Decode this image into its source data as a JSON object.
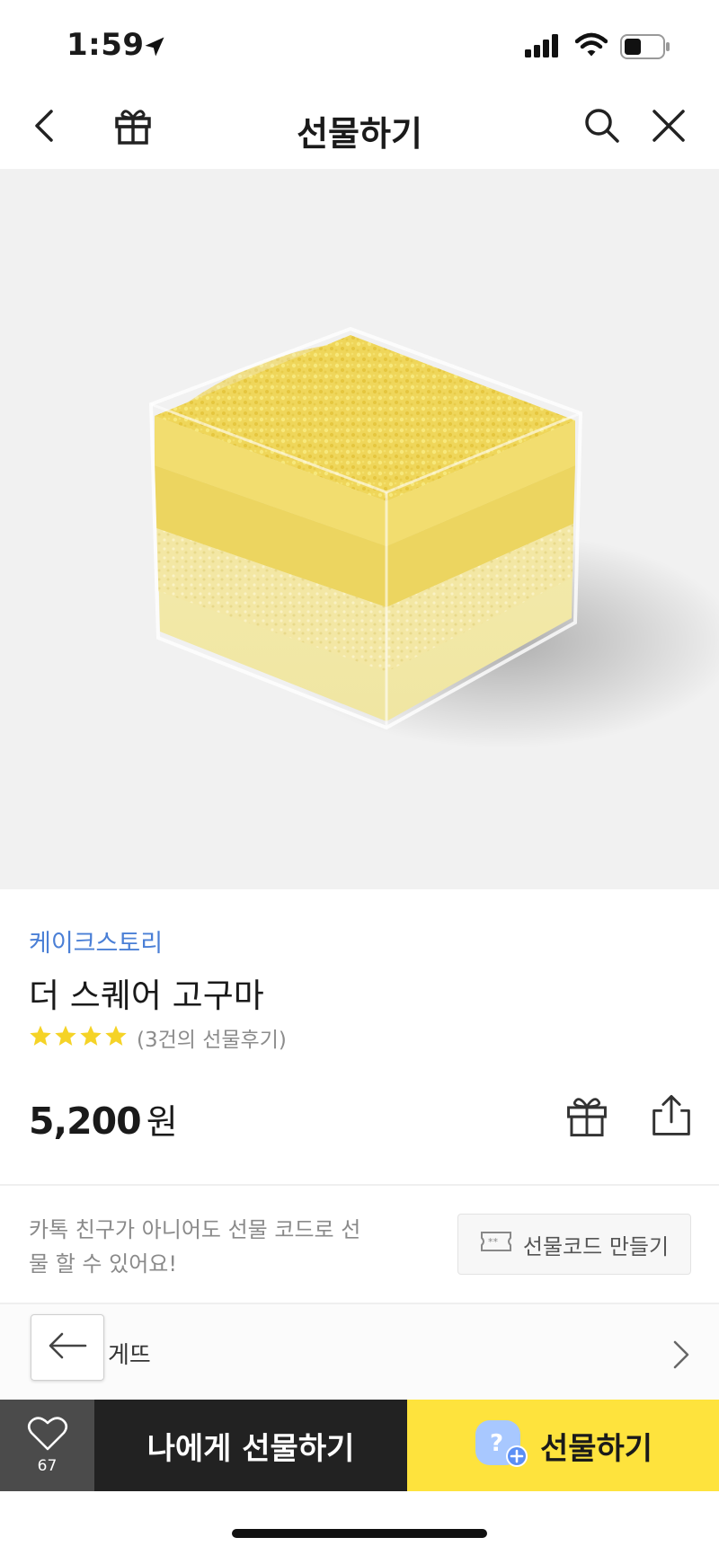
{
  "status_bar": {
    "time": "1:59"
  },
  "nav": {
    "title": "선물하기",
    "icons": [
      "back-icon",
      "gift-icon",
      "search-icon",
      "close-icon"
    ]
  },
  "product": {
    "brand": "케이크스토리",
    "name": "더 스퀘어 고구마",
    "rating_stars": 4,
    "review_text": "(3건의 선물후기)",
    "price": "5,200",
    "price_unit": "원"
  },
  "gift_code": {
    "description": "카톡 친구가 아니어도 선물 코드로 선물 할 수 있어요!",
    "button_label": "선물코드 만들기"
  },
  "row_link": {
    "label": "게뜨"
  },
  "action_bar": {
    "wish_count": "67",
    "self_gift_label": "나에게 선물하기",
    "gift_label": "선물하기"
  },
  "colors": {
    "brand_text": "#4a7fd6",
    "gift_button": "#fee33d",
    "self_gift_button": "#222222",
    "wish_button": "#4b4b4b",
    "star": "#f5d327"
  }
}
